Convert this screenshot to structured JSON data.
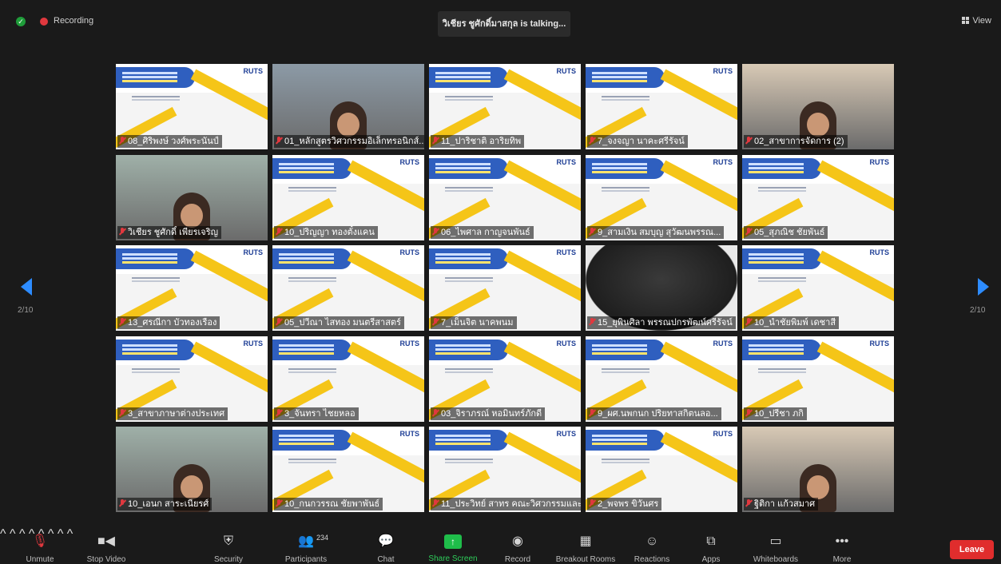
{
  "header": {
    "recording_label": "Recording",
    "talking_text": "วิเชียร ชูศักดิ์มาสกุล is talking...",
    "view_label": "View"
  },
  "navigation": {
    "page_left": "2/10",
    "page_right": "2/10"
  },
  "tiles": [
    {
      "name": "08_ศิริพงษ์ วงศ์พระนันป์",
      "kind": "slide"
    },
    {
      "name": "01_หลักสูตรวิศวกรรมอิเล็กทรอนิกส์...",
      "kind": "camera"
    },
    {
      "name": "11_ปาริชาติ อาริยทิพ",
      "kind": "slide"
    },
    {
      "name": "7_จงจญา นาคะศรีรัจน์",
      "kind": "slide"
    },
    {
      "name": "02_สาขาการจัดการ (2)",
      "kind": "camera"
    },
    {
      "name": "วิเชียร ชูศักดิ์ เพียรเจริญ",
      "kind": "camera"
    },
    {
      "name": "10_ปริญญา ทองตั๋งแคน",
      "kind": "slide"
    },
    {
      "name": "06_ไพศาล กาญจนพันธ์",
      "kind": "slide"
    },
    {
      "name": "9_สามเงิน สมบุญ สุวัฒนพรรณ...",
      "kind": "slide"
    },
    {
      "name": "05_สุภณิช ชัยพันธ์",
      "kind": "slide"
    },
    {
      "name": "13_ศรณีกา บัวทองเรือง",
      "kind": "slide"
    },
    {
      "name": "05_ปวีณา ไสทอง มนตรีสาสตร์",
      "kind": "slide"
    },
    {
      "name": "7_เม็นจิต นาคพนม",
      "kind": "slide"
    },
    {
      "name": "15_ยุพินศิลา พรรณปกรพัฒน์ศรีรัจน์",
      "kind": "blur"
    },
    {
      "name": "10_นำชัยพิมพ์ เดชาสี",
      "kind": "slide"
    },
    {
      "name": "3_สาขาภาษาต่างประเทศ",
      "kind": "slide"
    },
    {
      "name": "3_จันทรา ไชยหลอ",
      "kind": "slide"
    },
    {
      "name": "03_จิราภรณ์ หอมินทร์ภักดี",
      "kind": "slide"
    },
    {
      "name": "9_ผศ.นพกนก ปริยทาสกิตนลอ...",
      "kind": "slide"
    },
    {
      "name": "10_ปรีชา ภกิ",
      "kind": "slide"
    },
    {
      "name": "10_เอนก สาระเนียรศ์",
      "kind": "camera"
    },
    {
      "name": "10_กนกวรรณ ชัยพาพันธ์",
      "kind": "slide"
    },
    {
      "name": "11_ประวิทย์ สาทร คณะวิศวกรรมและ...",
      "kind": "slide"
    },
    {
      "name": "2_พจพร ขิวันศร",
      "kind": "slide"
    },
    {
      "name": "ฐิติกา แก้วสมาศ",
      "kind": "camera"
    }
  ],
  "slide_logo": "RUTS",
  "toolbar": {
    "unmute": "Unmute",
    "stop_video": "Stop Video",
    "security": "Security",
    "participants": "Participants",
    "participants_count": "234",
    "chat": "Chat",
    "share_screen": "Share Screen",
    "record": "Record",
    "breakout_rooms": "Breakout Rooms",
    "reactions": "Reactions",
    "apps": "Apps",
    "whiteboards": "Whiteboards",
    "more": "More",
    "leave": "Leave"
  }
}
